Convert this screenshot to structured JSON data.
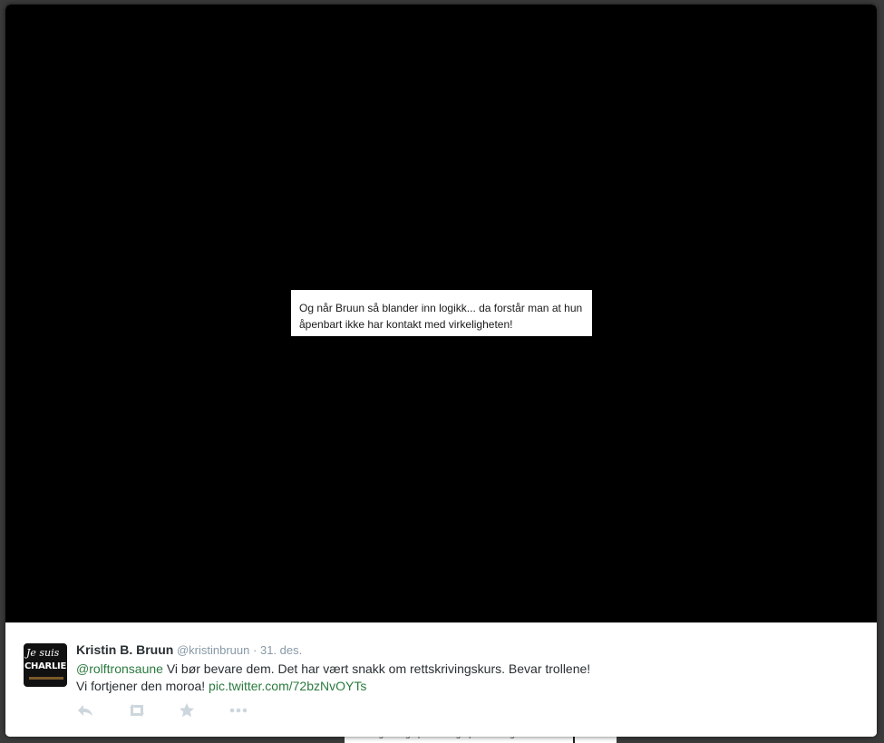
{
  "media": {
    "caption_text": "Og når Bruun så blander inn logikk... da forstår man at hun åpenbart ikke har kontakt med virkeligheten!"
  },
  "background": {
    "partial_text": "og studige personangrep. Som sagt så må man"
  },
  "tweet": {
    "avatar": {
      "line1": "Je suis",
      "line2": "CHARLIE"
    },
    "author_name": "Kristin B. Bruun",
    "author_handle": "@kristinbruun",
    "separator": "·",
    "date": "31. des.",
    "mention": "@rolftronsaune",
    "text_part1": " Vi bør bevare dem. Det har vært snakk om rettskrivingskurs. Bevar trollene!",
    "text_part2": "Vi fortjener den moroa! ",
    "pic_link": "pic.twitter.com/72bzNvOYTs"
  },
  "actions": {
    "icons": [
      "reply-icon",
      "retweet-icon",
      "favorite-icon",
      "more-icon"
    ]
  },
  "colors": {
    "link": "#2b7a3f",
    "action_icon": "#ccd6dd",
    "media_background": "#000000"
  }
}
